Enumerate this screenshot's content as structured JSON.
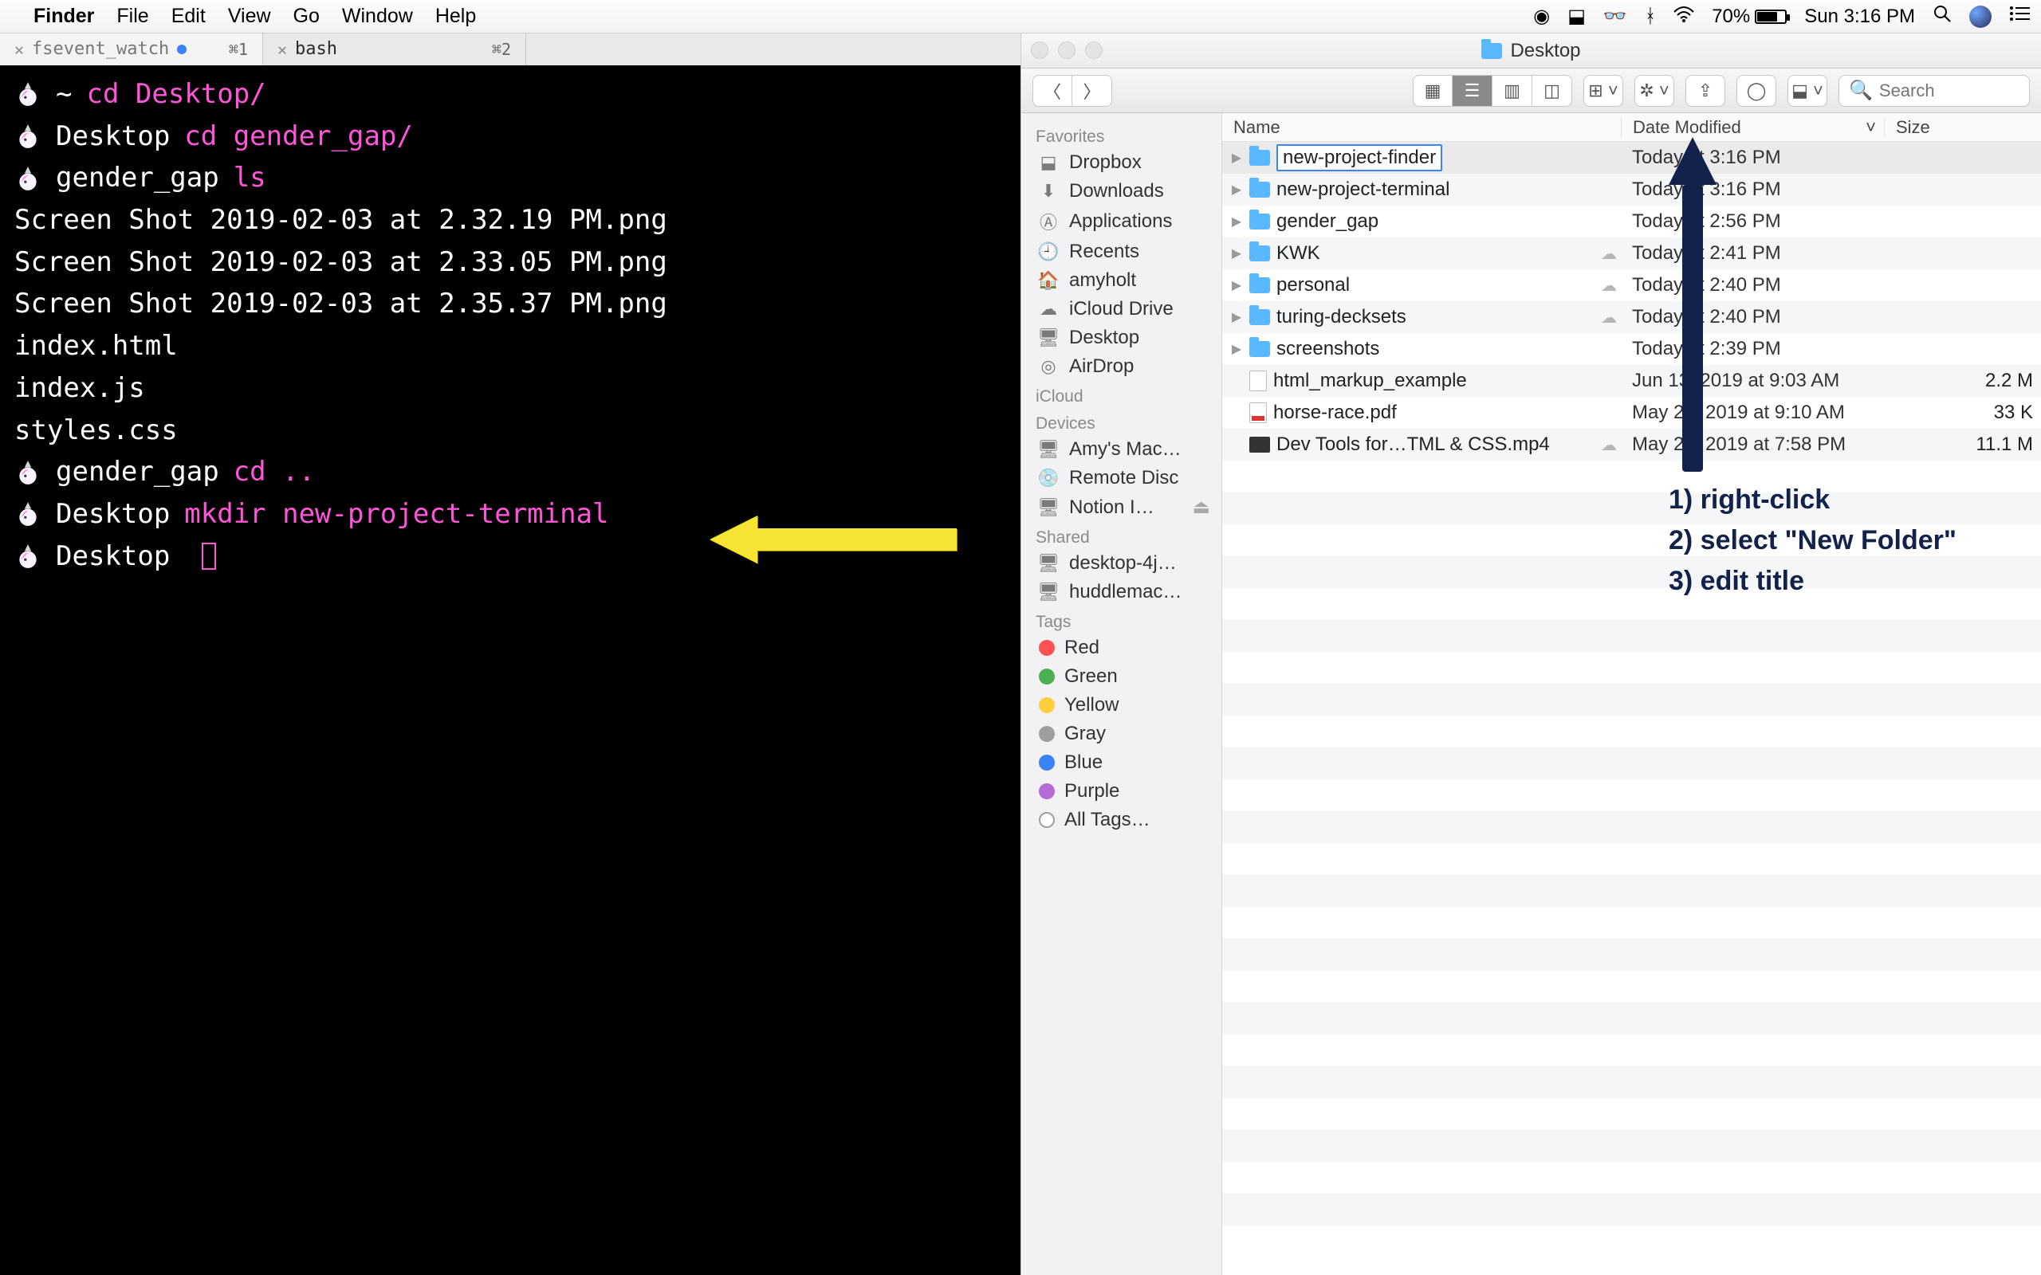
{
  "menubar": {
    "app_name": "Finder",
    "items": [
      "File",
      "Edit",
      "View",
      "Go",
      "Window",
      "Help"
    ],
    "battery_pct": "70%",
    "clock": "Sun 3:16 PM"
  },
  "terminal": {
    "tabs": [
      {
        "title": "fsevent_watch",
        "shortcut": "⌘1",
        "active": false,
        "dirty": true
      },
      {
        "title": "bash",
        "shortcut": "⌘2",
        "active": true,
        "dirty": false
      }
    ],
    "lines": [
      {
        "kind": "prompt",
        "cwd": "~",
        "cmd": "cd Desktop/"
      },
      {
        "kind": "prompt",
        "cwd": "Desktop",
        "cmd": "cd gender_gap/"
      },
      {
        "kind": "prompt",
        "cwd": "gender_gap",
        "cmd": "ls"
      },
      {
        "kind": "out",
        "text": "Screen Shot 2019-02-03 at 2.32.19 PM.png"
      },
      {
        "kind": "out",
        "text": "Screen Shot 2019-02-03 at 2.33.05 PM.png"
      },
      {
        "kind": "out",
        "text": "Screen Shot 2019-02-03 at 2.35.37 PM.png"
      },
      {
        "kind": "out",
        "text": "index.html"
      },
      {
        "kind": "out",
        "text": "index.js"
      },
      {
        "kind": "out",
        "text": "styles.css"
      },
      {
        "kind": "prompt",
        "cwd": "gender_gap",
        "cmd": "cd .."
      },
      {
        "kind": "prompt",
        "cwd": "Desktop",
        "cmd": "mkdir new-project-terminal"
      },
      {
        "kind": "prompt",
        "cwd": "Desktop",
        "cmd": ""
      }
    ]
  },
  "finder": {
    "title": "Desktop",
    "search_placeholder": "Search",
    "sidebar": {
      "favorites_label": "Favorites",
      "favorites": [
        "Dropbox",
        "Downloads",
        "Applications",
        "Recents",
        "amyholt",
        "iCloud Drive",
        "Desktop",
        "AirDrop"
      ],
      "icloud_label": "iCloud",
      "devices_label": "Devices",
      "devices": [
        "Amy's Mac…",
        "Remote Disc",
        "Notion I…"
      ],
      "shared_label": "Shared",
      "shared": [
        "desktop-4j…",
        "huddlemac…"
      ],
      "tags_label": "Tags",
      "tags": [
        {
          "name": "Red",
          "color": "red"
        },
        {
          "name": "Green",
          "color": "green"
        },
        {
          "name": "Yellow",
          "color": "yellow"
        },
        {
          "name": "Gray",
          "color": "gray"
        },
        {
          "name": "Blue",
          "color": "blue"
        },
        {
          "name": "Purple",
          "color": "purple"
        },
        {
          "name": "All Tags…",
          "color": "all"
        }
      ]
    },
    "columns": {
      "name": "Name",
      "date": "Date Modified",
      "size": "Size"
    },
    "rows": [
      {
        "type": "folder",
        "name": "new-project-finder",
        "date": "Today at 3:16 PM",
        "size": "",
        "cloud": false,
        "selected": true,
        "editing": true
      },
      {
        "type": "folder",
        "name": "new-project-terminal",
        "date": "Today at 3:16 PM",
        "size": "",
        "cloud": false
      },
      {
        "type": "folder",
        "name": "gender_gap",
        "date": "Today at 2:56 PM",
        "size": "",
        "cloud": false
      },
      {
        "type": "folder",
        "name": "KWK",
        "date": "Today at 2:41 PM",
        "size": "",
        "cloud": true
      },
      {
        "type": "folder",
        "name": "personal",
        "date": "Today at 2:40 PM",
        "size": "",
        "cloud": true
      },
      {
        "type": "folder",
        "name": "turing-decksets",
        "date": "Today at 2:40 PM",
        "size": "",
        "cloud": true
      },
      {
        "type": "folder",
        "name": "screenshots",
        "date": "Today at 2:39 PM",
        "size": "",
        "cloud": false
      },
      {
        "type": "file",
        "name": "html_markup_example",
        "date": "Jun 13, 2019 at 9:03 AM",
        "size": "2.2 M",
        "cloud": false
      },
      {
        "type": "pdf",
        "name": "horse-race.pdf",
        "date": "May 26, 2019 at 9:10 AM",
        "size": "33 K",
        "cloud": false
      },
      {
        "type": "mov",
        "name": "Dev Tools for…TML & CSS.mp4",
        "date": "May 21, 2019 at 7:58 PM",
        "size": "11.1 M",
        "cloud": true
      }
    ]
  },
  "annotations": {
    "steps": [
      "1) right-click",
      "2) select \"New Folder\"",
      "3) edit title"
    ]
  }
}
